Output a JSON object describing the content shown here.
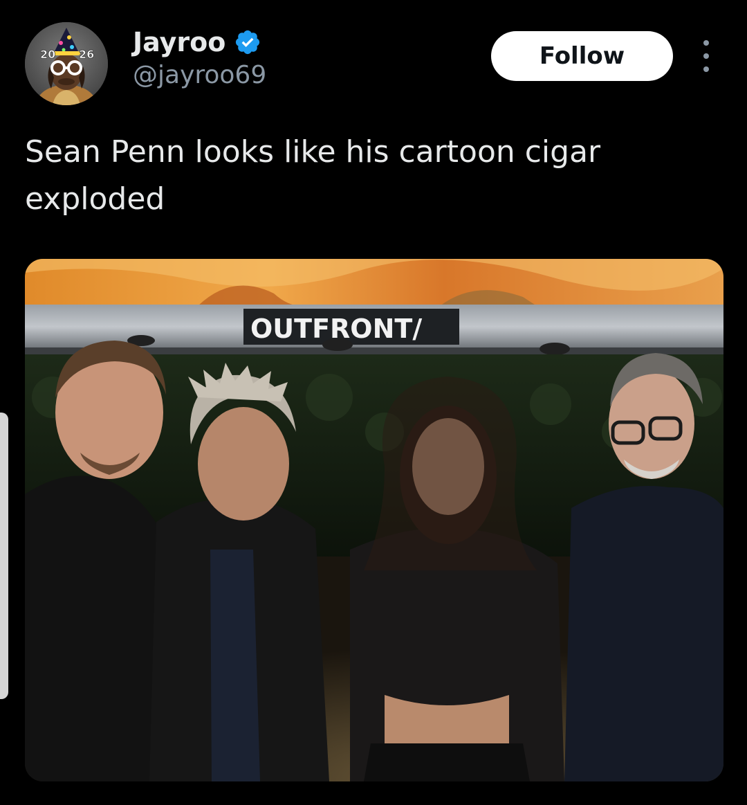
{
  "tweet": {
    "author": {
      "display_name": "Jayroo",
      "handle": "@jayroo69",
      "verified": true,
      "avatar_badge_text": "2026"
    },
    "follow_label": "Follow",
    "text": "Sean Penn looks like his cartoon cigar exploded",
    "media": {
      "sign_text": "OUTFRONT/"
    }
  },
  "colors": {
    "background": "#000000",
    "primary_text": "#e7e9ea",
    "secondary_text": "#8b98a5",
    "verified_blue": "#1d9bf0",
    "follow_bg": "#ffffff",
    "follow_text": "#0f1419"
  },
  "icons": {
    "verified": "verified-badge-icon",
    "more": "more-options-icon"
  }
}
